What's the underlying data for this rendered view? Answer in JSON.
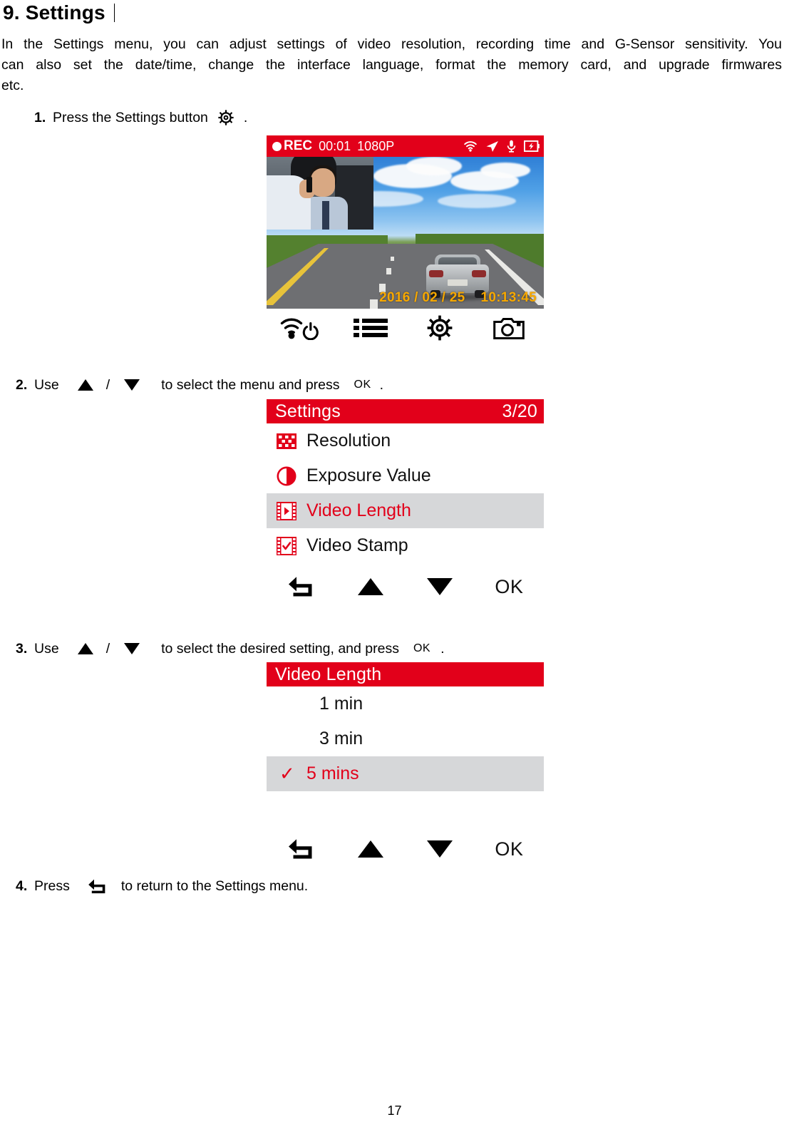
{
  "document": {
    "chapter_heading": "9. Settings",
    "page_number": "17",
    "intro_line1": "In the Settings menu, you can adjust settings of video resolution, recording time and G-Sensor sensitivity. You",
    "intro_line2": "can also set the date/time, change the interface language, format the memory card, and upgrade firmwares",
    "intro_line3": "etc."
  },
  "steps": {
    "step1": {
      "number": "1.",
      "text_before": "Press the Settings button",
      "icon": "gear-icon",
      "text_after": "."
    },
    "step2": {
      "number": "2.",
      "text_before": "Use",
      "icon_up": "triangle-up-icon",
      "separator": "/",
      "icon_down": "triangle-down-icon",
      "text_middle": "to select the menu and press",
      "ok_label": "OK",
      "text_after": "."
    },
    "step3": {
      "number": "3.",
      "text_before": "Use",
      "icon_up": "triangle-up-icon",
      "separator": "/",
      "icon_down": "triangle-down-icon",
      "text_middle": "to select the desired setting, and press",
      "ok_label": "OK",
      "text_after": "."
    },
    "step4": {
      "number": "4.",
      "text_before": "Press",
      "icon_back": "back-arrow-icon",
      "text_after": "to return to the Settings menu."
    }
  },
  "lcd_preview": {
    "rec_indicator": "REC",
    "rec_dot": "record-dot-icon",
    "timer": "00:01",
    "resolution": "1080P",
    "status_icons": [
      "wifi-icon",
      "gps-arrow-icon",
      "microphone-icon",
      "battery-charging-icon"
    ],
    "date_stamp": "2016 / 02 / 25",
    "time_stamp": "10:13:45",
    "inset_label": "driver-camera-inset"
  },
  "lcd_buttons": [
    {
      "name": "wifi-power-icon",
      "label": ""
    },
    {
      "name": "menu-list-icon",
      "label": ""
    },
    {
      "name": "settings-gear-icon",
      "label": ""
    },
    {
      "name": "camera-snapshot-icon",
      "label": ""
    }
  ],
  "settings_menu": {
    "title": "Settings",
    "counter": "3/20",
    "items": [
      {
        "label": "Resolution",
        "icon": "checkerboard-icon",
        "selected": false
      },
      {
        "label": "Exposure Value",
        "icon": "contrast-circle-icon",
        "selected": false
      },
      {
        "label": "Video Length",
        "icon": "film-play-icon",
        "selected": true
      },
      {
        "label": "Video Stamp",
        "icon": "film-check-icon",
        "selected": false
      }
    ],
    "nav": [
      {
        "name": "back-arrow-icon",
        "label": ""
      },
      {
        "name": "triangle-up-icon",
        "label": ""
      },
      {
        "name": "triangle-down-icon",
        "label": ""
      },
      {
        "name": "ok-button",
        "label": "OK"
      }
    ]
  },
  "video_length_menu": {
    "title": "Video Length",
    "options": [
      {
        "label": "1 min",
        "selected": false,
        "check": ""
      },
      {
        "label": "3 min",
        "selected": false,
        "check": ""
      },
      {
        "label": "5 mins",
        "selected": true,
        "check": "✓"
      }
    ],
    "nav": [
      {
        "name": "back-arrow-icon",
        "label": ""
      },
      {
        "name": "triangle-up-icon",
        "label": ""
      },
      {
        "name": "triangle-down-icon",
        "label": ""
      },
      {
        "name": "ok-button",
        "label": "OK"
      }
    ]
  },
  "colors": {
    "brand_red": "#e2001a",
    "selection_gray": "#d6d7d9",
    "stamp_orange": "#f7a800",
    "text_black": "#111111"
  }
}
